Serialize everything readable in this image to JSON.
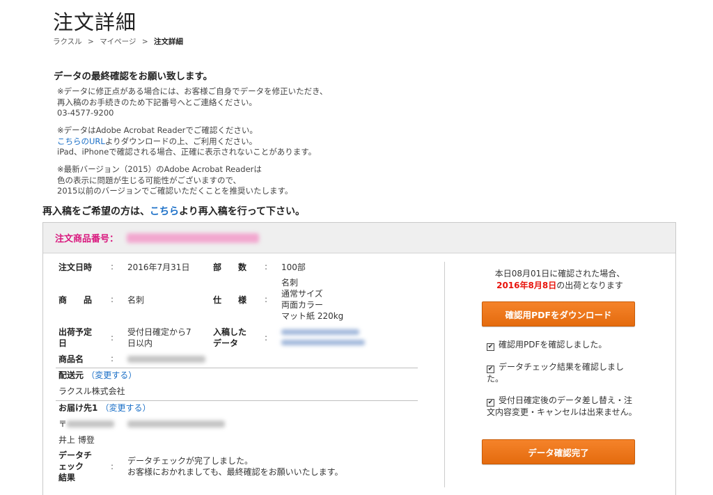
{
  "header": {
    "title": "注文詳細",
    "breadcrumb": [
      {
        "label": "ラクスル"
      },
      {
        "label": "マイページ"
      },
      {
        "label": "注文詳細"
      }
    ],
    "breadcrumb_sep": ">"
  },
  "notice": {
    "heading": "データの最終確認をお願い致します。",
    "block1": {
      "line1": "※データに修正点がある場合には、お客様ご自身でデータを修正いただき、",
      "line2": "再入稿のお手続きのため下記番号へとご連絡ください。",
      "phone": "03-4577-9200"
    },
    "block2": {
      "line1": "※データはAdobe Acrobat Readerでご確認ください。",
      "link": "こちらのURL",
      "line2_rest": "よりダウンロードの上、ご利用ください。",
      "line3": "iPad、iPhoneで確認される場合、正確に表示されないことがあります。"
    },
    "block3": {
      "line1": "※最新バージョン（2015）のAdobe Acrobat Readerは",
      "line2": "色の表示に問題が生じる可能性がございますので、",
      "line3": "2015以前のバージョンでご確認いただくことを推奨いたします。"
    }
  },
  "resubmit": {
    "prefix": "再入稿をご希望の方は、",
    "link": "こちら",
    "suffix": "より再入稿を行って下さい。"
  },
  "order": {
    "number_label": "注文商品番号：",
    "colon": ":",
    "order_date_label": "注文日時",
    "order_date": "2016年7月31日",
    "qty_label": "部　　数",
    "qty": "100部",
    "product_label": "商　　品",
    "product": "名刺",
    "spec_label": "仕　　様",
    "spec": [
      "名刺",
      "通常サイズ",
      "両面カラー",
      "マット紙 220kg"
    ],
    "ship_plan_label": [
      "出荷予定",
      "日"
    ],
    "ship_plan": [
      "受付日確定から7",
      "日以内"
    ],
    "submitted_label": [
      "入稿した",
      "データ"
    ],
    "product_name_label": "商品名",
    "sender_label": "配送元",
    "change_link": "（変更する）",
    "sender": "ラクスル株式会社",
    "dest_label": "お届け先1",
    "postal_mark": "〒",
    "recipient": "井上 博登",
    "check_label": [
      "データチ",
      "ェック",
      "結果"
    ],
    "check_result": [
      "データチェックが完了しました。",
      "お客様におかれましても、最終確認をお願いいたします。"
    ]
  },
  "sidebar": {
    "info_line1": "本日08月01日に確認された場合、",
    "info_date": "2016年8月8日",
    "info_suffix": "の出荷となります",
    "pdf_button": "確認用PDFをダウンロード",
    "checks": [
      {
        "label": "確認用PDFを確認しました。",
        "checked": true
      },
      {
        "label": "データチェック結果を確認しました。",
        "checked": true
      },
      {
        "label": "受付日確定後のデータ差し替え・注文内容変更・キャンセルは出来ません。",
        "checked": true
      }
    ],
    "done_button": "データ確認完了",
    "accent_color": "#f07a1f",
    "highlight_color": "#e8140c",
    "order_label_color": "#d9187e"
  }
}
